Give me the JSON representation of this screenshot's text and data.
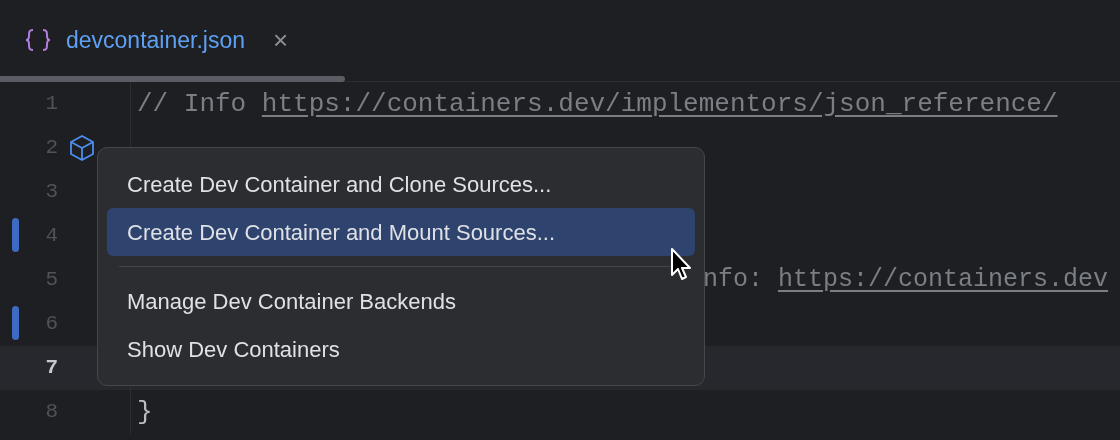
{
  "tabs": [
    {
      "label": "devcontainer.json",
      "close": "×",
      "selected": true
    }
  ],
  "editor": {
    "lines": [
      {
        "number": "1",
        "current": false,
        "changed": false,
        "gutter_icon": false,
        "clipped": false,
        "segments": [
          {
            "kind": "comment",
            "text": "// Info "
          },
          {
            "kind": "link",
            "text": "https://containers.dev/implementors/json_reference/"
          }
        ]
      },
      {
        "number": "2",
        "current": false,
        "changed": false,
        "gutter_icon": true
      },
      {
        "number": "3",
        "current": false,
        "changed": false,
        "gutter_icon": false
      },
      {
        "number": "4",
        "current": false,
        "changed": true,
        "gutter_icon": false
      },
      {
        "number": "5",
        "current": false,
        "changed": false,
        "gutter_icon": false,
        "clipped": true,
        "segments": [
          {
            "kind": "comment",
            "text": "nfo: "
          },
          {
            "kind": "link",
            "text": "https://containers.dev"
          }
        ]
      },
      {
        "number": "6",
        "current": false,
        "changed": true,
        "gutter_icon": false
      },
      {
        "number": "7",
        "current": true,
        "changed": false,
        "gutter_icon": false
      },
      {
        "number": "8",
        "current": false,
        "changed": false,
        "gutter_icon": false,
        "clipped": false,
        "segments": [
          {
            "kind": "brace",
            "text": "}"
          }
        ]
      }
    ]
  },
  "context_menu": {
    "items": [
      {
        "kind": "item",
        "label": "Create Dev Container and Clone Sources...",
        "selected": false
      },
      {
        "kind": "item",
        "label": "Create Dev Container and Mount Sources...",
        "selected": true
      },
      {
        "kind": "separator"
      },
      {
        "kind": "item",
        "label": "Manage Dev Container Backends",
        "selected": false
      },
      {
        "kind": "item",
        "label": "Show Dev Containers",
        "selected": false
      }
    ]
  }
}
